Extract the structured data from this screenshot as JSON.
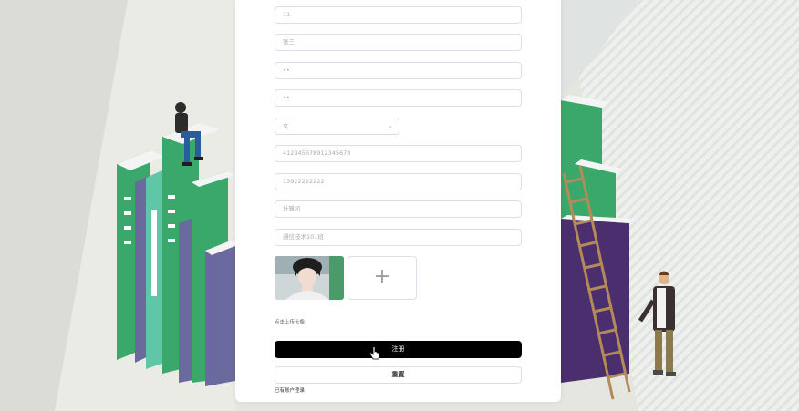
{
  "form": {
    "fields": [
      {
        "value": "11"
      },
      {
        "value": "张三"
      },
      {
        "value": "••"
      },
      {
        "value": "••"
      }
    ],
    "gender": {
      "value": "女"
    },
    "more_fields": [
      {
        "value": "412345678912345678"
      },
      {
        "value": "13922222222"
      },
      {
        "value": "计算机"
      },
      {
        "value": "通信技术101班"
      }
    ],
    "upload_plus": "+",
    "upload_hint": "点击上传头像",
    "register_label": "注册",
    "reset_label": "重置",
    "login_link": "已有账户登录"
  },
  "colors": {
    "accent": "#000000",
    "border": "#dcdfe6",
    "book_green": "#3aa86b",
    "book_purple": "#6b6a9e"
  }
}
